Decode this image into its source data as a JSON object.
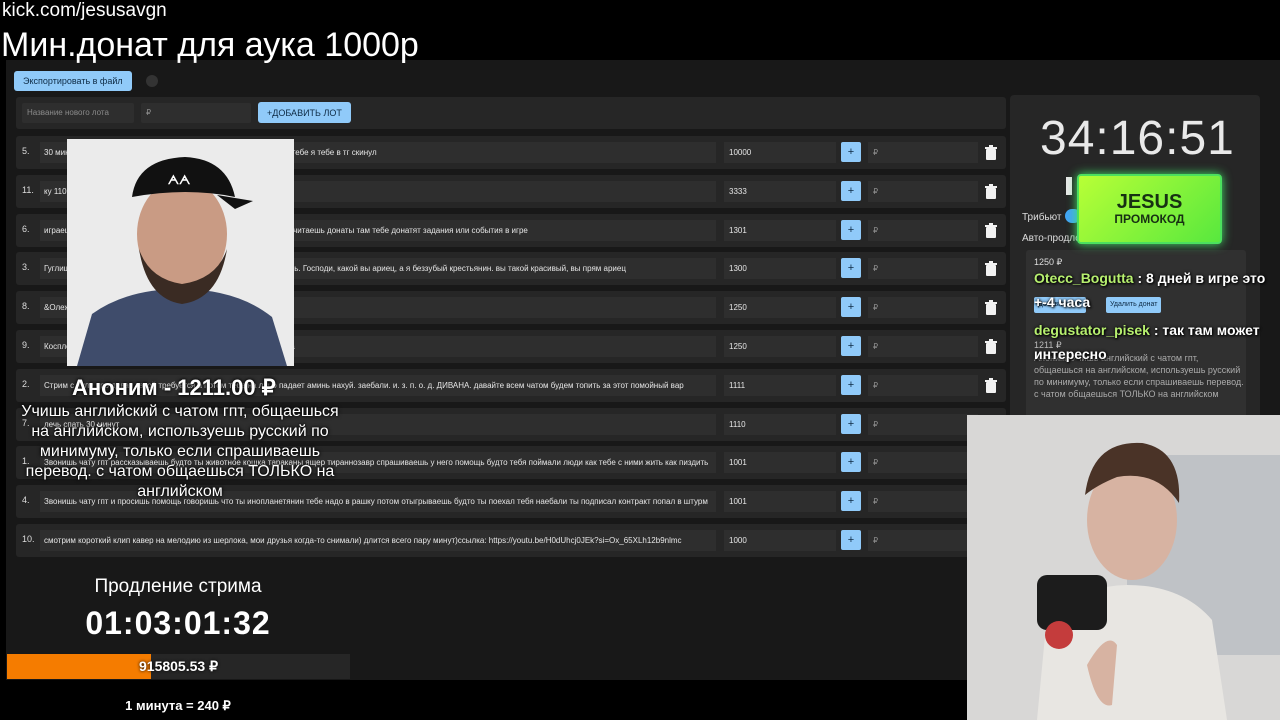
{
  "stream": {
    "url": "kick.com/jesusavgn",
    "headline": "Мин.донат для аука 1000р"
  },
  "app": {
    "export_button": "Экспортировать в файл",
    "new_lot_placeholder": "Название нового лота",
    "currency_placeholder": "₽",
    "add_lot_button": "+ДОБАВИТЬ ЛОТ",
    "plus_label": "+",
    "lots": [
      {
        "num": "5.",
        "name": "30 минут пиши ты что хочешь, а я тебе мы договоримся о том что тебе я тебе в тг скинул",
        "amount": "10000"
      },
      {
        "num": "11.",
        "name": "ку 110",
        "amount": "3333"
      },
      {
        "num": "6.",
        "name": "играешь в игру где ты работаешь на компанию он твой компаньон читаешь донаты там тебе донатят задания или события в игре",
        "amount": "1301"
      },
      {
        "num": "3.",
        "name": "Гуглишь себя и смотришь на свои старые фото с фотками говоришь. Господи, какой вы ариец, а я беззубый крестьянин. вы такой красивый, вы прям ариец",
        "amount": "1300"
      },
      {
        "num": "8.",
        "name": "&Олежка",
        "amount": "1250"
      },
      {
        "num": "9.",
        "name": "Косплей на нового ведущего новостей в его стиле новости полчаса",
        "amount": "1250"
      },
      {
        "num": "2.",
        "name": "Стрим с нуля про диван такой требуется а потом тебе на лицо падает аминь нахуй. заебали. и. з. п. о. д. ДИВАНА. давайте всем чатом будем топить за этот помойный вар",
        "amount": "1111"
      },
      {
        "num": "7.",
        "name": "лечь спать 30 минут",
        "amount": "1110"
      },
      {
        "num": "1.",
        "name": "Звонишь чату гпт рассказываешь будто ты животное кошка тараканы ящер тираннозавр спрашиваешь у него помощь будто тебя поймали люди как тебе с ними жить как пиздить",
        "amount": "1001"
      },
      {
        "num": "4.",
        "name": "Звонишь чату гпт и просишь помощь говоришь что ты инопланетянин тебе надо в рашку потом отыгрываешь будто ты поехал тебя наебали ты подписал контракт попал в штурм",
        "amount": "1001"
      },
      {
        "num": "10.",
        "name": "смотрим короткий клип кавер на мелодию из шерлока, мои друзья когда-то снимали) длится всего пару минут)ссылка: https://youtu.be/H0dUhcj0JEk?si=Ox_65XLh12b9nlmc",
        "amount": "1000"
      }
    ]
  },
  "side": {
    "timer": "34:16:51",
    "label_tribute": "Трибьют",
    "label_auto": "Авто-продление",
    "winner_amount": "1250 ₽",
    "winner_amount2": "1211 ₽",
    "add_button": "Добавить лот",
    "delete_button": "Удалить донат",
    "winner_text": "Аноним: Учишь английский с чатом гпт, общаешься на английском, используешь русский по минимуму, только если спрашиваешь перевод. с чатом общаешься ТОЛЬКО на английском"
  },
  "promo": {
    "title": "JESUS",
    "subtitle": "ПРОМОКОД"
  },
  "chat": [
    {
      "user": "Otecc_Bogutta",
      "text": " : 8 дней в игре это +-4 часа"
    },
    {
      "user": "degustator_pisek",
      "text": " : так там может интересно"
    }
  ],
  "donation": {
    "title": "Аноним - 1211.00 ₽",
    "message": "Учишь английский с чатом гпт, общаешься на английском, используешь русский по минимуму, только если спрашиваешь перевод. с чатом общаешься ТОЛЬКО на английском"
  },
  "extension": {
    "label": "Продление стрима",
    "timer": "01:03:01:32",
    "amount": "915805.53 ₽",
    "progress_fraction": 0.42,
    "rate": "1 минута = 240 ₽"
  },
  "colors": {
    "accent": "#90caf9",
    "progress": "#f57c00",
    "chat_user": "#b7f06f",
    "promo": "#8cf33a"
  }
}
